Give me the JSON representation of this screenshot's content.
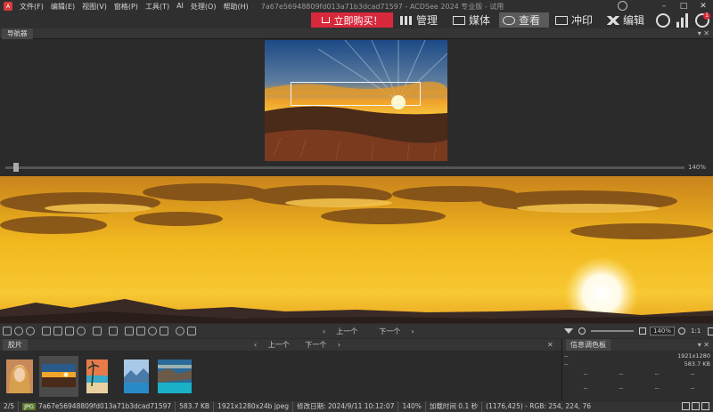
{
  "window": {
    "app_icon": "A",
    "title": "7a67e56948809fd013a71b3dcad71597 - ACDSee 2024 专业版 - 试用",
    "menu": [
      "文件(F)",
      "编辑(E)",
      "视图(V)",
      "窗格(P)",
      "工具(T)",
      "AI",
      "处理(O)",
      "帮助(H)"
    ],
    "controls": {
      "minimize": "–",
      "maximize": "□",
      "close": "✕"
    }
  },
  "modes": {
    "buy_label": "立即购买！",
    "buy_icon": "cart-icon",
    "items": [
      {
        "label": "管理",
        "icon": "grid-icon"
      },
      {
        "label": "媒体",
        "icon": "media-icon"
      },
      {
        "label": "查看",
        "icon": "eye-icon",
        "active": true
      },
      {
        "label": "冲印",
        "icon": "develop-icon"
      },
      {
        "label": "编辑",
        "icon": "edit-icon"
      }
    ],
    "notification_count": "1",
    "accent": "#d8293c"
  },
  "navigator": {
    "tab": "导航器",
    "controls": "▾ ✕",
    "zoom_label": "140%"
  },
  "toolbar": {
    "prev": "上一个",
    "next": "下一个",
    "zoom": "140%",
    "ratio": "1:1",
    "prev_arrow": "‹",
    "next_arrow": "›"
  },
  "filmstrip": {
    "tab": "胶片",
    "prev": "上一个",
    "next": "下一个",
    "controls": "✕",
    "prev_arrow": "‹",
    "next_arrow": "›"
  },
  "info_palette": {
    "tab": "信息调色板",
    "controls": "▾ ✕",
    "dimensions": "1921x1280",
    "size": "583.7 KB",
    "placeholder": "--",
    "grid": [
      "--",
      "--",
      "--",
      "--",
      "--",
      "--",
      "--",
      "--",
      "--"
    ]
  },
  "status": {
    "position": "2/5",
    "badge": "JPG",
    "filename": "7a67e56948809fd013a71b3dcad71597",
    "filesize": "583.7 KB",
    "format": "1921x1280x24b jpeg",
    "modified": "修改日期: 2024/9/11 10:12:07",
    "zoom": "140%",
    "loadtime": "加载时间 0.1 秒",
    "pixel": "(1176,425) - RGB: 254, 224, 76"
  }
}
